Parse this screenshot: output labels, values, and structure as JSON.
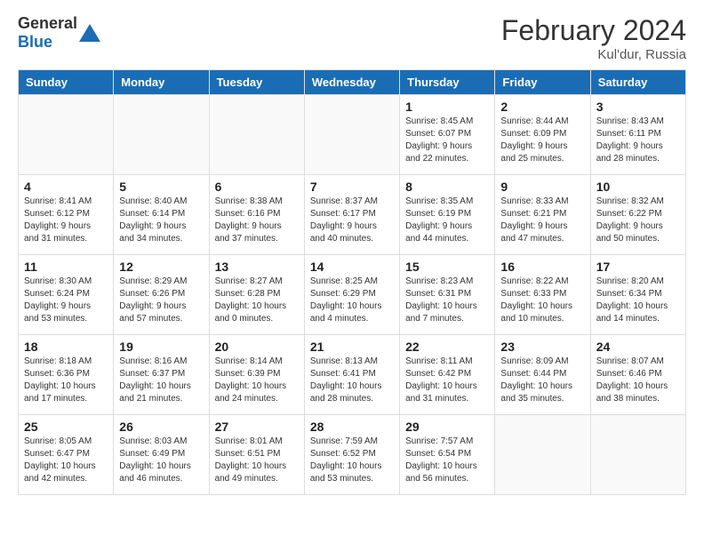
{
  "header": {
    "logo_general": "General",
    "logo_blue": "Blue",
    "month_title": "February 2024",
    "subtitle": "Kul'dur, Russia"
  },
  "days_of_week": [
    "Sunday",
    "Monday",
    "Tuesday",
    "Wednesday",
    "Thursday",
    "Friday",
    "Saturday"
  ],
  "weeks": [
    {
      "days": [
        {
          "number": "",
          "info": ""
        },
        {
          "number": "",
          "info": ""
        },
        {
          "number": "",
          "info": ""
        },
        {
          "number": "",
          "info": ""
        },
        {
          "number": "1",
          "info": "Sunrise: 8:45 AM\nSunset: 6:07 PM\nDaylight: 9 hours and 22 minutes."
        },
        {
          "number": "2",
          "info": "Sunrise: 8:44 AM\nSunset: 6:09 PM\nDaylight: 9 hours and 25 minutes."
        },
        {
          "number": "3",
          "info": "Sunrise: 8:43 AM\nSunset: 6:11 PM\nDaylight: 9 hours and 28 minutes."
        }
      ]
    },
    {
      "days": [
        {
          "number": "4",
          "info": "Sunrise: 8:41 AM\nSunset: 6:12 PM\nDaylight: 9 hours and 31 minutes."
        },
        {
          "number": "5",
          "info": "Sunrise: 8:40 AM\nSunset: 6:14 PM\nDaylight: 9 hours and 34 minutes."
        },
        {
          "number": "6",
          "info": "Sunrise: 8:38 AM\nSunset: 6:16 PM\nDaylight: 9 hours and 37 minutes."
        },
        {
          "number": "7",
          "info": "Sunrise: 8:37 AM\nSunset: 6:17 PM\nDaylight: 9 hours and 40 minutes."
        },
        {
          "number": "8",
          "info": "Sunrise: 8:35 AM\nSunset: 6:19 PM\nDaylight: 9 hours and 44 minutes."
        },
        {
          "number": "9",
          "info": "Sunrise: 8:33 AM\nSunset: 6:21 PM\nDaylight: 9 hours and 47 minutes."
        },
        {
          "number": "10",
          "info": "Sunrise: 8:32 AM\nSunset: 6:22 PM\nDaylight: 9 hours and 50 minutes."
        }
      ]
    },
    {
      "days": [
        {
          "number": "11",
          "info": "Sunrise: 8:30 AM\nSunset: 6:24 PM\nDaylight: 9 hours and 53 minutes."
        },
        {
          "number": "12",
          "info": "Sunrise: 8:29 AM\nSunset: 6:26 PM\nDaylight: 9 hours and 57 minutes."
        },
        {
          "number": "13",
          "info": "Sunrise: 8:27 AM\nSunset: 6:28 PM\nDaylight: 10 hours and 0 minutes."
        },
        {
          "number": "14",
          "info": "Sunrise: 8:25 AM\nSunset: 6:29 PM\nDaylight: 10 hours and 4 minutes."
        },
        {
          "number": "15",
          "info": "Sunrise: 8:23 AM\nSunset: 6:31 PM\nDaylight: 10 hours and 7 minutes."
        },
        {
          "number": "16",
          "info": "Sunrise: 8:22 AM\nSunset: 6:33 PM\nDaylight: 10 hours and 10 minutes."
        },
        {
          "number": "17",
          "info": "Sunrise: 8:20 AM\nSunset: 6:34 PM\nDaylight: 10 hours and 14 minutes."
        }
      ]
    },
    {
      "days": [
        {
          "number": "18",
          "info": "Sunrise: 8:18 AM\nSunset: 6:36 PM\nDaylight: 10 hours and 17 minutes."
        },
        {
          "number": "19",
          "info": "Sunrise: 8:16 AM\nSunset: 6:37 PM\nDaylight: 10 hours and 21 minutes."
        },
        {
          "number": "20",
          "info": "Sunrise: 8:14 AM\nSunset: 6:39 PM\nDaylight: 10 hours and 24 minutes."
        },
        {
          "number": "21",
          "info": "Sunrise: 8:13 AM\nSunset: 6:41 PM\nDaylight: 10 hours and 28 minutes."
        },
        {
          "number": "22",
          "info": "Sunrise: 8:11 AM\nSunset: 6:42 PM\nDaylight: 10 hours and 31 minutes."
        },
        {
          "number": "23",
          "info": "Sunrise: 8:09 AM\nSunset: 6:44 PM\nDaylight: 10 hours and 35 minutes."
        },
        {
          "number": "24",
          "info": "Sunrise: 8:07 AM\nSunset: 6:46 PM\nDaylight: 10 hours and 38 minutes."
        }
      ]
    },
    {
      "days": [
        {
          "number": "25",
          "info": "Sunrise: 8:05 AM\nSunset: 6:47 PM\nDaylight: 10 hours and 42 minutes."
        },
        {
          "number": "26",
          "info": "Sunrise: 8:03 AM\nSunset: 6:49 PM\nDaylight: 10 hours and 46 minutes."
        },
        {
          "number": "27",
          "info": "Sunrise: 8:01 AM\nSunset: 6:51 PM\nDaylight: 10 hours and 49 minutes."
        },
        {
          "number": "28",
          "info": "Sunrise: 7:59 AM\nSunset: 6:52 PM\nDaylight: 10 hours and 53 minutes."
        },
        {
          "number": "29",
          "info": "Sunrise: 7:57 AM\nSunset: 6:54 PM\nDaylight: 10 hours and 56 minutes."
        },
        {
          "number": "",
          "info": ""
        },
        {
          "number": "",
          "info": ""
        }
      ]
    }
  ]
}
